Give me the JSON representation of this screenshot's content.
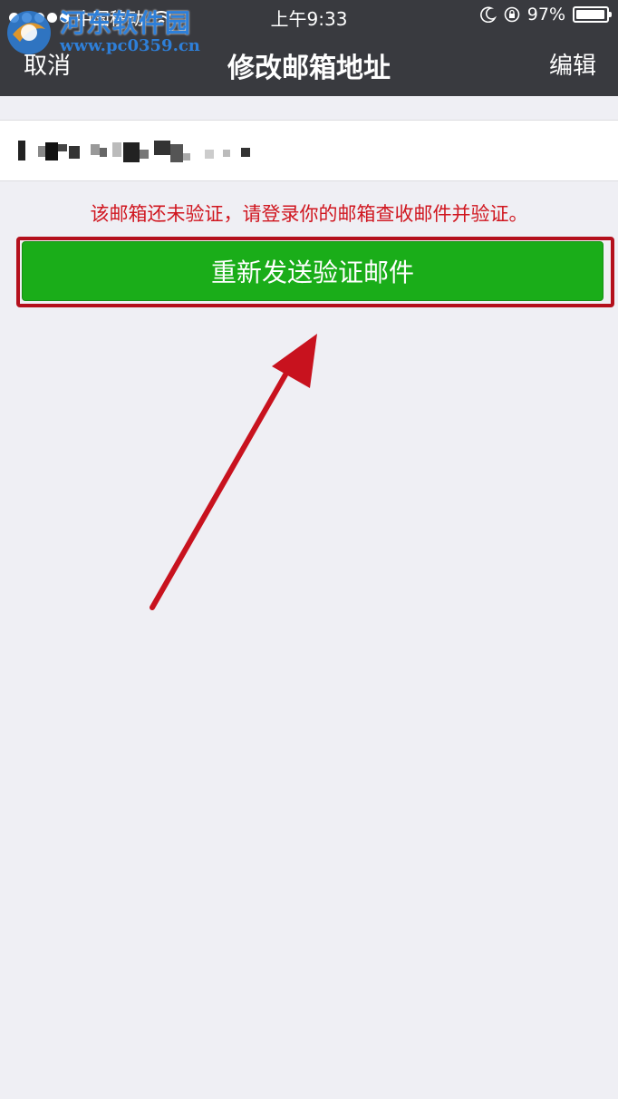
{
  "status_bar": {
    "carrier": "中国移动",
    "time": "上午9:33",
    "battery": "97%",
    "battery_level": 0.97,
    "icons": [
      "signal-dots-icon",
      "wifi-icon",
      "moon-icon",
      "rotation-lock-icon",
      "battery-icon"
    ]
  },
  "nav": {
    "cancel_label": "取消",
    "title": "修改邮箱地址",
    "edit_label": "编辑"
  },
  "watermark": {
    "title": "河东软件园",
    "url": "www.pc0359.cn"
  },
  "email_field": {
    "value_redacted": true
  },
  "notice": "该邮箱还未验证，请登录你的邮箱查收邮件并验证。",
  "resend_button": {
    "label": "重新发送验证邮件"
  },
  "colors": {
    "nav_bg": "#393a3f",
    "page_bg": "#efeff4",
    "button_green": "#1aad19",
    "notice_red": "#d0161f",
    "annotation_red": "#b4101c"
  }
}
